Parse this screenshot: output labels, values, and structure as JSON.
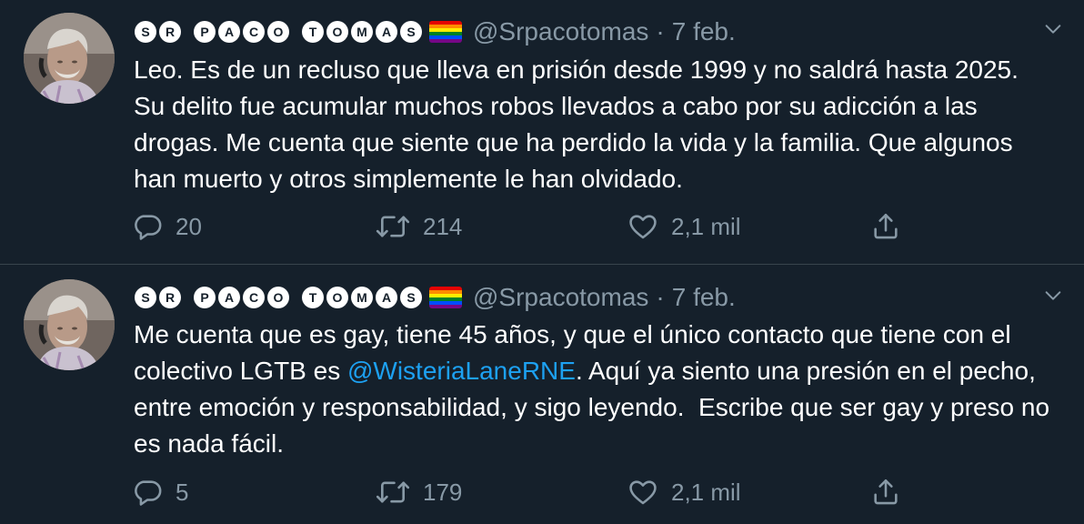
{
  "tweets": [
    {
      "author": {
        "name_chars": [
          "S",
          "R",
          "",
          "P",
          "A",
          "C",
          "O",
          "",
          "T",
          "O",
          "M",
          "A",
          "S"
        ],
        "handle": "@Srpacotomas",
        "avatar_icon": "avatar-photo"
      },
      "separator": "·",
      "date": "7 feb.",
      "text_before": "Leo. Es de un recluso que lleva en prisión desde 1999 y no saldrá hasta 2025. Su delito fue acumular muchos robos llevados a cabo por su adicción a las drogas. Me cuenta que siente que ha perdido la vida y la familia. Que algunos han muerto y otros simplemente le han olvidado.",
      "mention": "",
      "text_after": "",
      "reply_count": "20",
      "retweet_count": "214",
      "like_count": "2,1 mil"
    },
    {
      "author": {
        "name_chars": [
          "S",
          "R",
          "",
          "P",
          "A",
          "C",
          "O",
          "",
          "T",
          "O",
          "M",
          "A",
          "S"
        ],
        "handle": "@Srpacotomas",
        "avatar_icon": "avatar-photo"
      },
      "separator": "·",
      "date": "7 feb.",
      "text_before": "Me cuenta que es gay, tiene 45 años, y que el único contacto que tiene con el colectivo LGTB es ",
      "mention": "@WisteriaLaneRNE",
      "text_after": ". Aquí ya siento una presión en el pecho, entre emoción y responsabilidad, y sigo leyendo.  Escribe que ser gay y preso no es nada fácil.",
      "reply_count": "5",
      "retweet_count": "179",
      "like_count": "2,1 mil"
    }
  ],
  "colors": {
    "background": "#15202b",
    "secondary_text": "#8899a6",
    "link": "#1da1f2",
    "divider": "#38444d"
  },
  "icons": [
    "reply-icon",
    "retweet-icon",
    "like-icon",
    "share-icon",
    "chevron-down-icon",
    "rainbow-flag-icon"
  ]
}
